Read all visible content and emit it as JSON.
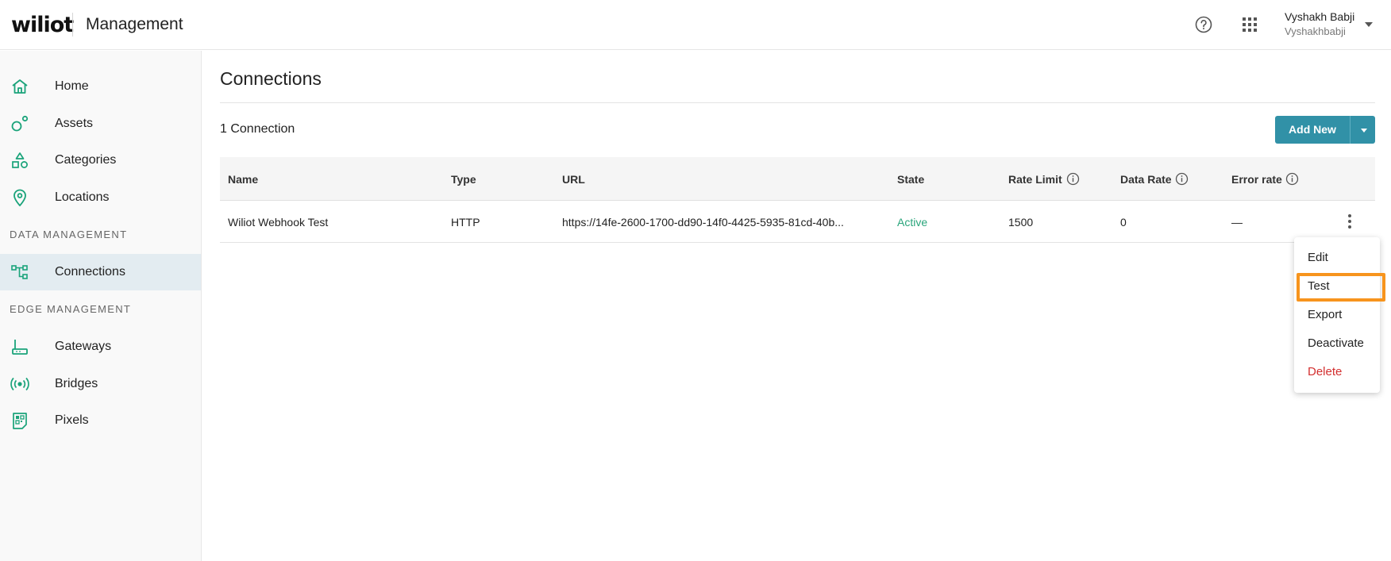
{
  "header": {
    "logo": "wiliot",
    "app_title": "Management",
    "user_name": "Vyshakh Babji",
    "user_handle": "Vyshakhbabji",
    "icons": [
      "help-circle-icon",
      "apps-grid-icon",
      "caret-down-icon"
    ]
  },
  "sidebar": {
    "items": [
      {
        "label": "Home",
        "icon": "home-icon"
      },
      {
        "label": "Assets",
        "icon": "assets-icon"
      },
      {
        "label": "Categories",
        "icon": "categories-icon"
      },
      {
        "label": "Locations",
        "icon": "location-pin-icon"
      }
    ],
    "section_data": "DATA MANAGEMENT",
    "data_items": [
      {
        "label": "Connections",
        "icon": "connections-icon",
        "active": true
      }
    ],
    "section_edge": "EDGE MANAGEMENT",
    "edge_items": [
      {
        "label": "Gateways",
        "icon": "gateway-icon"
      },
      {
        "label": "Bridges",
        "icon": "bridge-broadcast-icon"
      },
      {
        "label": "Pixels",
        "icon": "pixel-tag-icon"
      }
    ]
  },
  "main": {
    "title": "Connections",
    "count": "1 Connection",
    "add_new_label": "Add New"
  },
  "table": {
    "columns": [
      "Name",
      "Type",
      "URL",
      "State",
      "Rate Limit",
      "Data Rate",
      "Error rate"
    ],
    "rows": [
      {
        "name": "Wiliot Webhook Test",
        "type": "HTTP",
        "url": "https://14fe-2600-1700-dd90-14f0-4425-5935-81cd-40b...",
        "state": "Active",
        "rate_limit": "1500",
        "data_rate": "0",
        "error_rate": "—"
      }
    ]
  },
  "menu": {
    "items": [
      "Edit",
      "Test",
      "Export",
      "Deactivate",
      "Delete"
    ],
    "highlighted": "Test"
  },
  "colors": {
    "accent": "#3191a7",
    "active_state": "#2aa57b",
    "nav_icon": "#1aa37a",
    "danger": "#d32f2f",
    "highlight_box": "#f7941d",
    "active_nav_bg": "#e3ecf1"
  }
}
